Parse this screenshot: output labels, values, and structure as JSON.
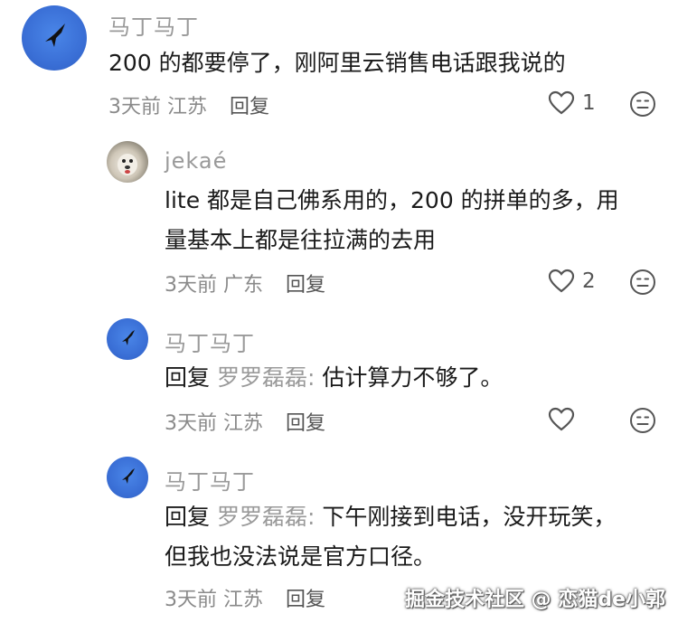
{
  "comments": [
    {
      "author": "马丁马丁",
      "avatar": "bird-avatar",
      "lines": [
        "200 的都要停了，刚阿里云销售电话跟我说的"
      ],
      "date": "3天前",
      "location": "江苏",
      "reply_label": "回复",
      "likes": "1"
    },
    {
      "author": "jekaé",
      "avatar": "dog-avatar",
      "lines": [
        "lite 都是自己佛系用的，200 的拼单的多，用",
        "量基本上都是往拉满的去用"
      ],
      "date": "3天前",
      "location": "广东",
      "reply_label": "回复",
      "likes": "2"
    },
    {
      "author": "马丁马丁",
      "avatar": "bird-avatar",
      "prefix": "回复",
      "reply_to": "罗罗磊磊:",
      "lines": [
        " 估计算力不够了。"
      ],
      "date": "3天前",
      "location": "江苏",
      "reply_label": "回复",
      "likes": ""
    },
    {
      "author": "马丁马丁",
      "avatar": "bird-avatar",
      "prefix": "回复",
      "reply_to": "罗罗磊磊:",
      "lines": [
        " 下午刚接到电话，没开玩笑，",
        "但我也没法说是官方口径。"
      ],
      "date": "3天前",
      "location": "江苏",
      "reply_label": "回复",
      "likes": ""
    }
  ],
  "watermark": "掘金技术社区 @ 恋猫de小郭",
  "colors": {
    "avatar_blue": "#3a6fd6",
    "muted_text": "#9a9a9a",
    "icon_stroke": "#555555"
  }
}
